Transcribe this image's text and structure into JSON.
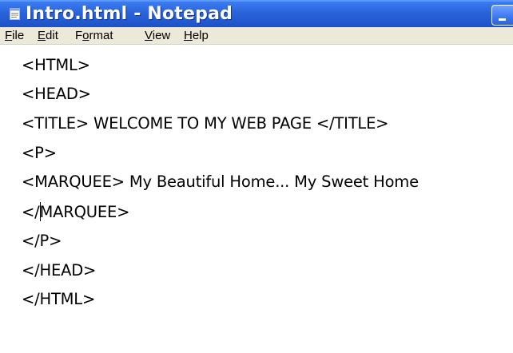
{
  "window": {
    "title": "Intro.html - Notepad"
  },
  "icons": {
    "app": "notepad-icon",
    "minimize": "minimize-icon"
  },
  "menu": {
    "items": [
      {
        "label_acc": "F",
        "label_rest": "ile"
      },
      {
        "label_acc": "E",
        "label_rest": "dit"
      },
      {
        "label_pre": "F",
        "label_acc": "o",
        "label_rest": "rmat"
      },
      {
        "label_acc": "V",
        "label_rest": "iew"
      },
      {
        "label_acc": "H",
        "label_rest": "elp"
      }
    ]
  },
  "editor": {
    "lines": [
      "<HTML>",
      "<HEAD>",
      "<TITLE> WELCOME TO MY WEB PAGE </TITLE>",
      "<P>",
      "<MARQUEE> My Beautiful Home... My Sweet Home",
      "</MARQUEE>",
      "</P>",
      "</HEAD>",
      "</HTML>"
    ],
    "caret_line_before": "</",
    "caret_line_after": "MARQUEE>"
  },
  "colors": {
    "titlebar": "#2a63d9",
    "menubar": "#ece9d8",
    "editor_background": "#ffffff"
  }
}
